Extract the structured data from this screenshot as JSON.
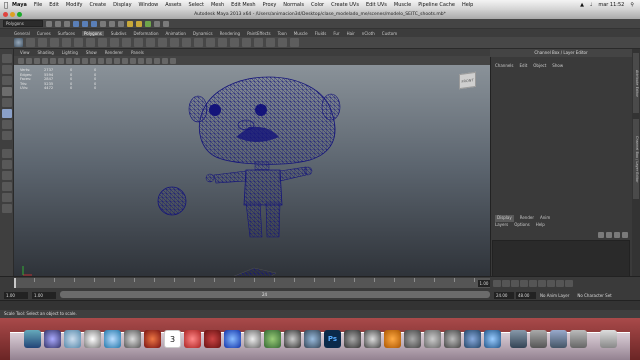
{
  "menubar": {
    "app": "Maya",
    "items": [
      "File",
      "Edit",
      "Modify",
      "Create",
      "Display",
      "Window",
      "Assets",
      "Select",
      "Mesh",
      "Edit Mesh",
      "Proxy",
      "Normals",
      "Color",
      "Create UVs",
      "Edit UVs",
      "Muscle",
      "Pipeline Cache",
      "Help"
    ],
    "clock": "mar 11:52"
  },
  "window": {
    "title": "Autodesk Maya 2013 x64 - /Users/animacion3d/Desktop/clase_modelado_me/scenes/modelo_SEITC_shoots.mb*"
  },
  "status_line": {
    "menu_set": "Polygons"
  },
  "shelf": {
    "tabs": [
      "General",
      "Curves",
      "Surfaces",
      "Polygons",
      "Subdivs",
      "Deformation",
      "Animation",
      "Dynamics",
      "Rendering",
      "PaintEffects",
      "Toon",
      "Muscle",
      "Fluids",
      "Fur",
      "Hair",
      "nCloth",
      "Custom"
    ],
    "active": "Polygons"
  },
  "viewport": {
    "menu": [
      "View",
      "Shading",
      "Lighting",
      "Show",
      "Renderer",
      "Panels"
    ],
    "hud": [
      [
        "Verts:",
        "2737",
        "0",
        "0"
      ],
      [
        "Edges:",
        "5594",
        "0",
        "0"
      ],
      [
        "Faces:",
        "2847",
        "0",
        "0"
      ],
      [
        "Tris:",
        "5235",
        "0",
        "0"
      ],
      [
        "UVs:",
        "4472",
        "0",
        "0"
      ]
    ],
    "viewcube_label": "FRONT"
  },
  "channel_box": {
    "header": "Channel Box / Layer Editor",
    "menu": [
      "Channels",
      "Edit",
      "Object",
      "Show"
    ]
  },
  "layer_editor": {
    "tabs": [
      "Display",
      "Render",
      "Anim"
    ],
    "active": "Display",
    "menu": [
      "Layers",
      "Options",
      "Help"
    ]
  },
  "side_tabs": [
    "Attribute Editor",
    "Channel Box / Layer Editor"
  ],
  "time_slider": {
    "current_frame": "1.00"
  },
  "range_slider": {
    "start": "1.00",
    "inner_start": "1.00",
    "inner_end": "24.00",
    "end": "48.00",
    "range_label": "24",
    "anim_layer": "No Anim Layer",
    "character_set": "No Character Set"
  },
  "help_line": "Scale Tool: Select an object to scale.",
  "colors": {
    "wireframe": "#14147a",
    "active_tab": "#5a5a5a"
  },
  "dock": {
    "calendar_day": "3"
  }
}
